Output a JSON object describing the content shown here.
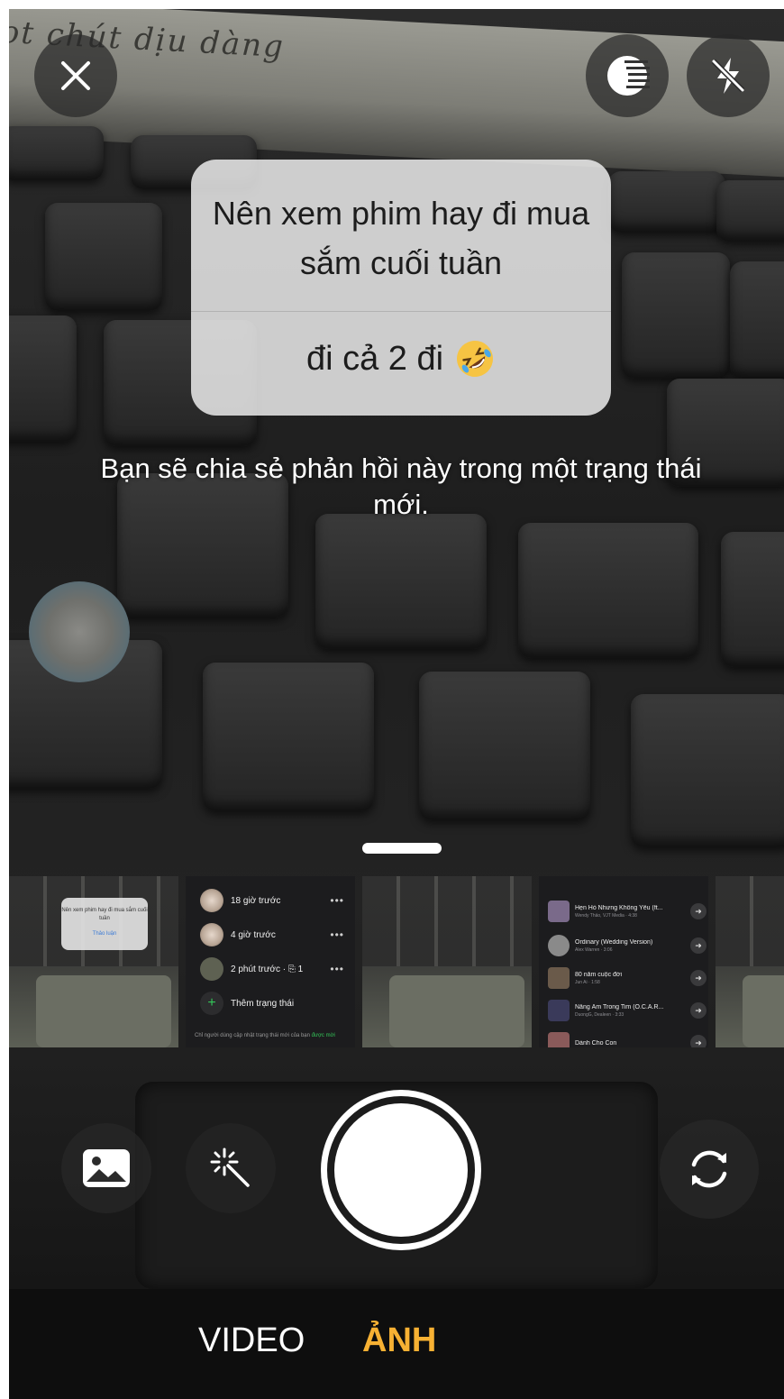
{
  "question_card": {
    "question": "Nên xem phim hay đi mua sắm cuối tuần",
    "answer": "đi cả 2 đi",
    "answer_emoji_icon": "rolling-on-floor-laughing-emoji-icon"
  },
  "share_note": "Bạn sẽ chia sẻ phản hồi này trong một trạng thái mới.",
  "top_controls": {
    "close_icon": "close-icon",
    "filter_icon": "filter-icon",
    "flash_icon": "flash-off-icon"
  },
  "recent_media": {
    "thumb1": {
      "question": "Nên xem phim hay đi mua sắm cuối tuần",
      "answer": "Thảo luận"
    },
    "thumb2": {
      "rows": [
        {
          "time": "18 giờ trước",
          "menu": "•••"
        },
        {
          "time": "4 giờ trước",
          "menu": "•••"
        },
        {
          "time": "2 phút trước · ⎘ 1",
          "menu": "•••"
        }
      ],
      "add_status": "Thêm trạng thái",
      "privacy_note": "Chỉ người dùng cập nhật trạng thái mới của bạn",
      "privacy_link": "được mời"
    },
    "thumb4": {
      "tracks": [
        {
          "title": "Hẹn Hò Nhưng Không Yêu (ft...",
          "artist": "Wendy Thảo, VJT Media · 4:38"
        },
        {
          "title": "Ordinary (Wedding Version)",
          "artist": "Alex Warren · 3:06"
        },
        {
          "title": "80 năm cuộc đời",
          "artist": "Jun Ai · 1:58"
        },
        {
          "title": "Nắng Ấm Trong Tim (O.C.A.R...",
          "artist": "DuongG, Dealeen · 3:33"
        },
        {
          "title": "Dành Cho Con",
          "artist": ""
        }
      ]
    }
  },
  "bottom_controls": {
    "gallery_icon": "gallery-icon",
    "effects_icon": "magic-wand-icon",
    "switch_camera_icon": "switch-camera-icon"
  },
  "modes": {
    "video": "VIDEO",
    "photo": "ẢNH",
    "active": "photo",
    "active_color": "#f7b133"
  }
}
